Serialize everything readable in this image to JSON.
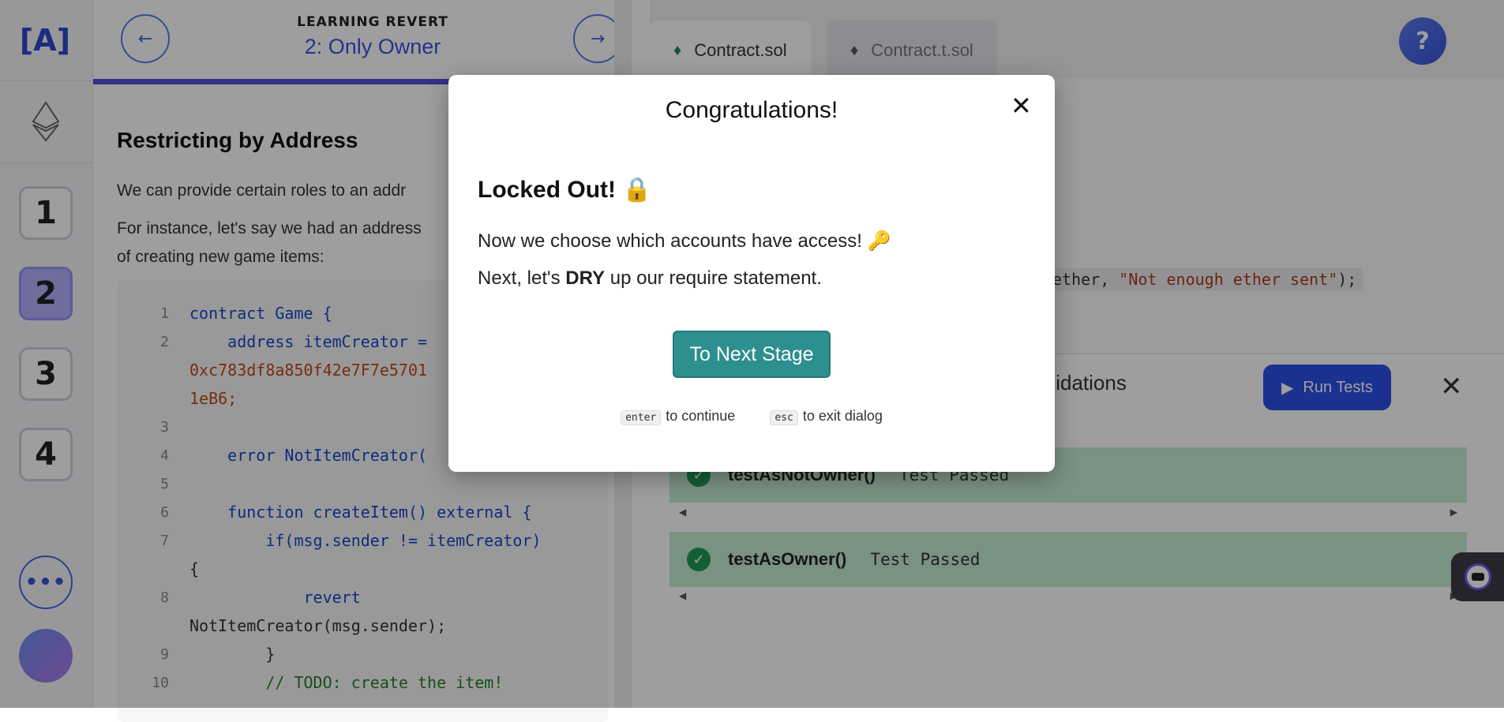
{
  "app": {
    "logo_text": "[A]"
  },
  "sidebar": {
    "stages": [
      "1",
      "2",
      "3",
      "4"
    ],
    "active_stage": "2",
    "more_label": "•••"
  },
  "lesson": {
    "course": "LEARNING REVERT",
    "title": "2: Only Owner",
    "heading": "Restricting by Address",
    "para1": "We can provide certain roles to an addr",
    "para2a": "For instance, let's say we had an address",
    "para2b": "of creating new game items:",
    "progress": 0.68,
    "code": [
      {
        "n": "1",
        "t": "contract Game {"
      },
      {
        "n": "2",
        "t": "    address itemCreator ="
      },
      {
        "n": "",
        "t": "0xc783df8a850f42e7F7e5701"
      },
      {
        "n": "",
        "t": "1eB6;"
      },
      {
        "n": "3",
        "t": ""
      },
      {
        "n": "4",
        "t": "    error NotItemCreator("
      },
      {
        "n": "5",
        "t": ""
      },
      {
        "n": "6",
        "t": "    function createItem() external {"
      },
      {
        "n": "7",
        "t": "        if(msg.sender != itemCreator)"
      },
      {
        "n": "",
        "t": "{"
      },
      {
        "n": "8",
        "t": "            revert"
      },
      {
        "n": "",
        "t": "NotItemCreator(msg.sender);"
      },
      {
        "n": "9",
        "t": "        }"
      },
      {
        "n": "10",
        "t": "        // TODO: create the item!"
      }
    ]
  },
  "editor": {
    "tabs": [
      {
        "label": "Contract.sol"
      },
      {
        "label": "Contract.t.sol"
      }
    ],
    "code_fragment_a": "ether, ",
    "code_fragment_b": "\"Not enough ether sent\"",
    "code_fragment_c": ");",
    "help_label": "?"
  },
  "tests_panel": {
    "title_fragment": "alidations",
    "run_label": "Run Tests",
    "close_label": "✕",
    "tests": [
      {
        "name": "testAsNotOwner()",
        "status": "Test Passed"
      },
      {
        "name": "testAsOwner()",
        "status": "Test Passed"
      }
    ]
  },
  "modal": {
    "title": "Congratulations!",
    "close": "✕",
    "heading": "Locked Out! 🔒",
    "line1": "Now we choose which accounts have access! 🔑",
    "line2_pre": "Next, let's ",
    "line2_bold": "DRY",
    "line2_post": " up our require statement.",
    "button": "To Next Stage",
    "hint_enter_key": "enter",
    "hint_enter_text": "to continue",
    "hint_esc_key": "esc",
    "hint_esc_text": "to exit dialog"
  }
}
